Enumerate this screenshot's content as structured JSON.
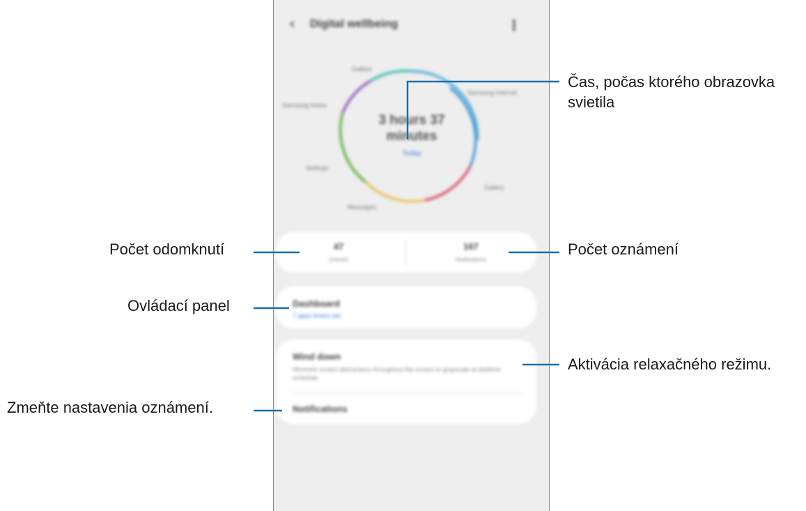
{
  "app": {
    "title": "Digital wellbeing",
    "back_icon": "chevron-left-icon",
    "more_icon": "more-vertical-icon"
  },
  "usage": {
    "total_time": "3 hours 37 minutes",
    "period": "Today",
    "apps": [
      {
        "label": "Gallery",
        "color": "#5fb4d9"
      },
      {
        "label": "Samsung Internet",
        "color": "#5b9fd6"
      },
      {
        "label": "Gallery",
        "color": "#d9607a"
      },
      {
        "label": "Messages",
        "color": "#e8c565"
      },
      {
        "label": "Settings",
        "color": "#6fb85a"
      },
      {
        "label": "Samsung Notes",
        "color": "#9b6bbf"
      }
    ]
  },
  "stats": {
    "unlocks_value": "47",
    "unlocks_label": "Unlocks",
    "notifications_value": "167",
    "notifications_label": "Notifications"
  },
  "dashboard": {
    "title": "Dashboard",
    "subtitle": "7 apps timers set"
  },
  "wind_down": {
    "title": "Wind down",
    "description": "Minimise screen distractions throughout the screen to grayscale at bedtime schedule."
  },
  "notifications_item": {
    "label": "Notifications"
  },
  "annotations": {
    "screen_time_line1": "Čas, počas ktorého obrazovka",
    "screen_time_line2": "svietila",
    "unlocks": "Počet odomknutí",
    "notifications_count": "Počet oznámení",
    "dashboard": "Ovládací panel",
    "wind_down": "Aktivácia relaxačného režimu.",
    "notification_settings": "Zmeňte nastavenia oznámení."
  },
  "colors": {
    "callout_line": "#1a6fa8",
    "accent": "#3d7bd6"
  }
}
